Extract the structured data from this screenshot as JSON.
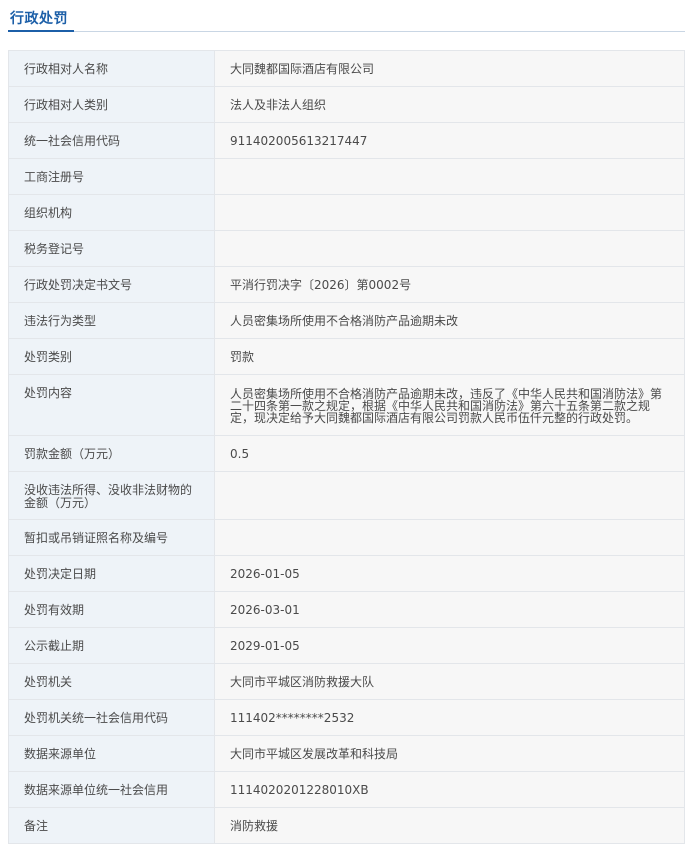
{
  "section": {
    "title": "行政处罚"
  },
  "rows": [
    {
      "label": "行政相对人名称",
      "value": "大同魏都国际酒店有限公司"
    },
    {
      "label": "行政相对人类别",
      "value": "法人及非法人组织"
    },
    {
      "label": "统一社会信用代码",
      "value": "911402005613217447"
    },
    {
      "label": "工商注册号",
      "value": ""
    },
    {
      "label": "组织机构",
      "value": ""
    },
    {
      "label": "税务登记号",
      "value": ""
    },
    {
      "label": "行政处罚决定书文号",
      "value": "平消行罚决字〔2026〕第0002号"
    },
    {
      "label": "违法行为类型",
      "value": "人员密集场所使用不合格消防产品逾期未改"
    },
    {
      "label": "处罚类别",
      "value": "罚款"
    },
    {
      "label": "处罚内容",
      "value": "人员密集场所使用不合格消防产品逾期未改，违反了《中华人民共和国消防法》第二十四条第一款之规定，根据《中华人民共和国消防法》第六十五条第二款之规定，现决定给予大同魏都国际酒店有限公司罚款人民币伍仟元整的行政处罚。"
    },
    {
      "label": "罚款金额（万元）",
      "value": "0.5"
    },
    {
      "label": "没收违法所得、没收非法财物的金额（万元）",
      "value": ""
    },
    {
      "label": "暂扣或吊销证照名称及编号",
      "value": ""
    },
    {
      "label": "处罚决定日期",
      "value": "2026-01-05"
    },
    {
      "label": "处罚有效期",
      "value": "2026-03-01"
    },
    {
      "label": "公示截止期",
      "value": "2029-01-05"
    },
    {
      "label": "处罚机关",
      "value": "大同市平城区消防救援大队"
    },
    {
      "label": "处罚机关统一社会信用代码",
      "value": "111402********2532"
    },
    {
      "label": "数据来源单位",
      "value": "大同市平城区发展改革和科技局"
    },
    {
      "label": "数据来源单位统一社会信用",
      "value": "1114020201228010XB"
    },
    {
      "label": "备注",
      "value": "消防救援"
    }
  ]
}
